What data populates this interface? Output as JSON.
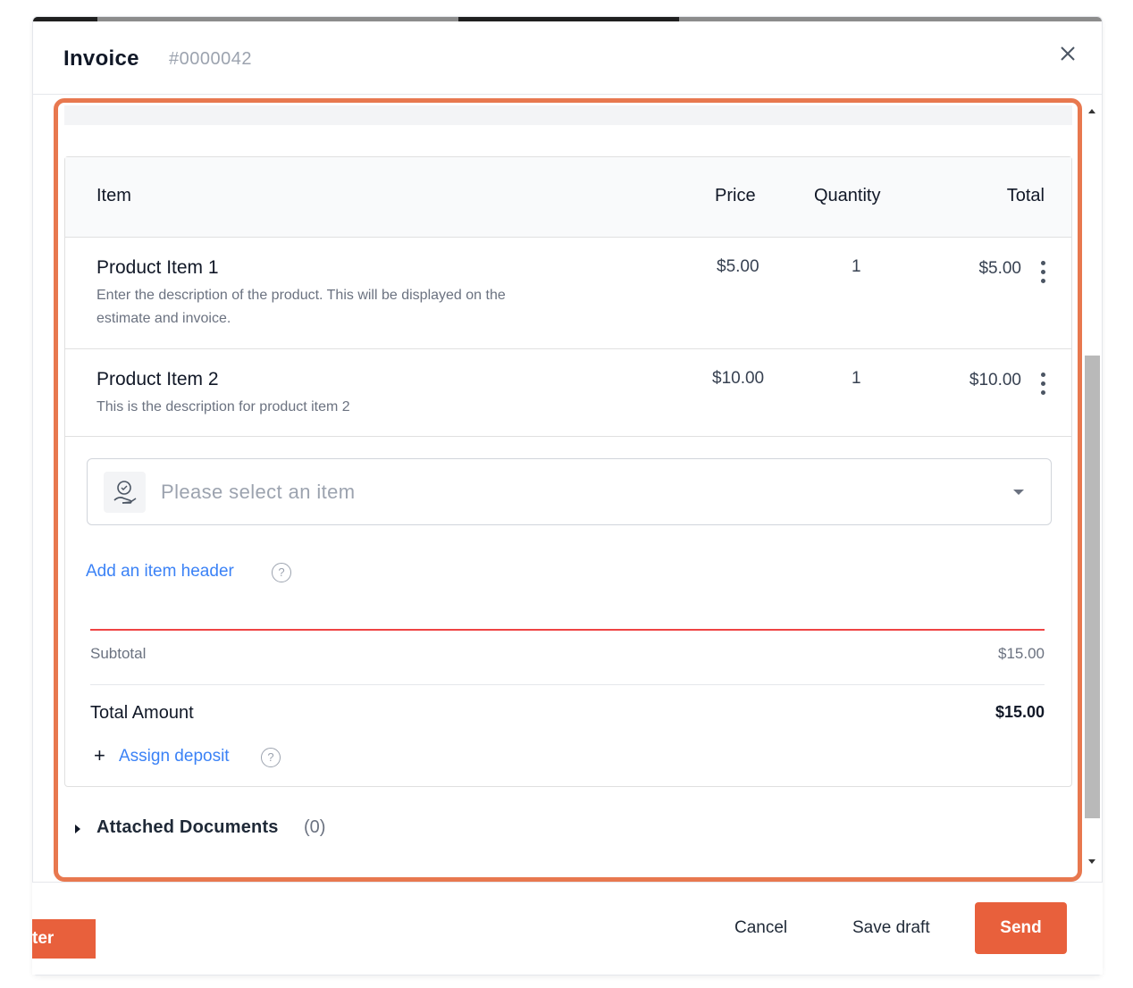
{
  "header": {
    "title": "Invoice",
    "invoice_number": "#0000042"
  },
  "table": {
    "columns": {
      "item": "Item",
      "price": "Price",
      "quantity": "Quantity",
      "total": "Total"
    },
    "rows": [
      {
        "name": "Product Item 1",
        "description_line1": "Enter the description of the product. This will be displayed on the",
        "description_line2": "estimate and invoice.",
        "price": "$5.00",
        "quantity": "1",
        "total": "$5.00"
      },
      {
        "name": "Product Item 2",
        "description_line1": "This is the description for product item 2",
        "price": "$10.00",
        "quantity": "1",
        "total": "$10.00"
      }
    ]
  },
  "item_select": {
    "placeholder": "Please select an item"
  },
  "links": {
    "add_item_header": "Add an item header",
    "assign_deposit": "Assign deposit"
  },
  "summary": {
    "subtotal_label": "Subtotal",
    "subtotal_value": "$15.00",
    "total_label": "Total Amount",
    "total_value": "$15.00"
  },
  "attachments": {
    "label": "Attached Documents",
    "count": "(0)"
  },
  "footer": {
    "left_button_partial": "ter",
    "cancel": "Cancel",
    "save_draft": "Save draft",
    "send": "Send"
  },
  "colors": {
    "accent": "#e8603c",
    "highlight_border": "#e8784f",
    "link": "#3b82f6",
    "divider_red": "#ef4444"
  },
  "icons": [
    "close-icon",
    "kebab-menu-icon",
    "product-icon",
    "chevron-down-icon",
    "help-icon",
    "plus-icon",
    "caret-right-icon",
    "scroll-up-icon",
    "scroll-down-icon"
  ]
}
